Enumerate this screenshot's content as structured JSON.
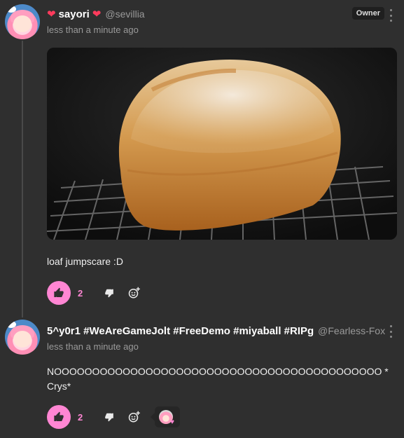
{
  "comments": [
    {
      "display_name": "sayori",
      "username": "@sevillia",
      "timestamp": "less than a minute ago",
      "badge": "Owner",
      "image_alt": "loaf of bread on a cooling rack",
      "text": "loaf jumpscare :D",
      "likes": "2"
    },
    {
      "display_name": "5^y0r1 #WeAreGameJolt #FreeDemo #miyaball #RIPg",
      "username": "@Fearless-Fox",
      "timestamp": "less than a minute ago",
      "text": "NOOOOOOOOOOOOOOOOOOOOOOOOOOOOOOOOOOOOOOOOOOO *Crys*",
      "likes": "2"
    }
  ],
  "icons": {
    "heart": "heart-icon",
    "more": "more-vertical-icon",
    "like": "thumbs-up-icon",
    "dislike": "thumbs-down-icon",
    "reaction": "add-reaction-icon"
  },
  "colors": {
    "background": "#2f2f2f",
    "accent": "#ff86d3",
    "heart": "#ff3b5c",
    "muted_text": "#9a9a9a"
  }
}
